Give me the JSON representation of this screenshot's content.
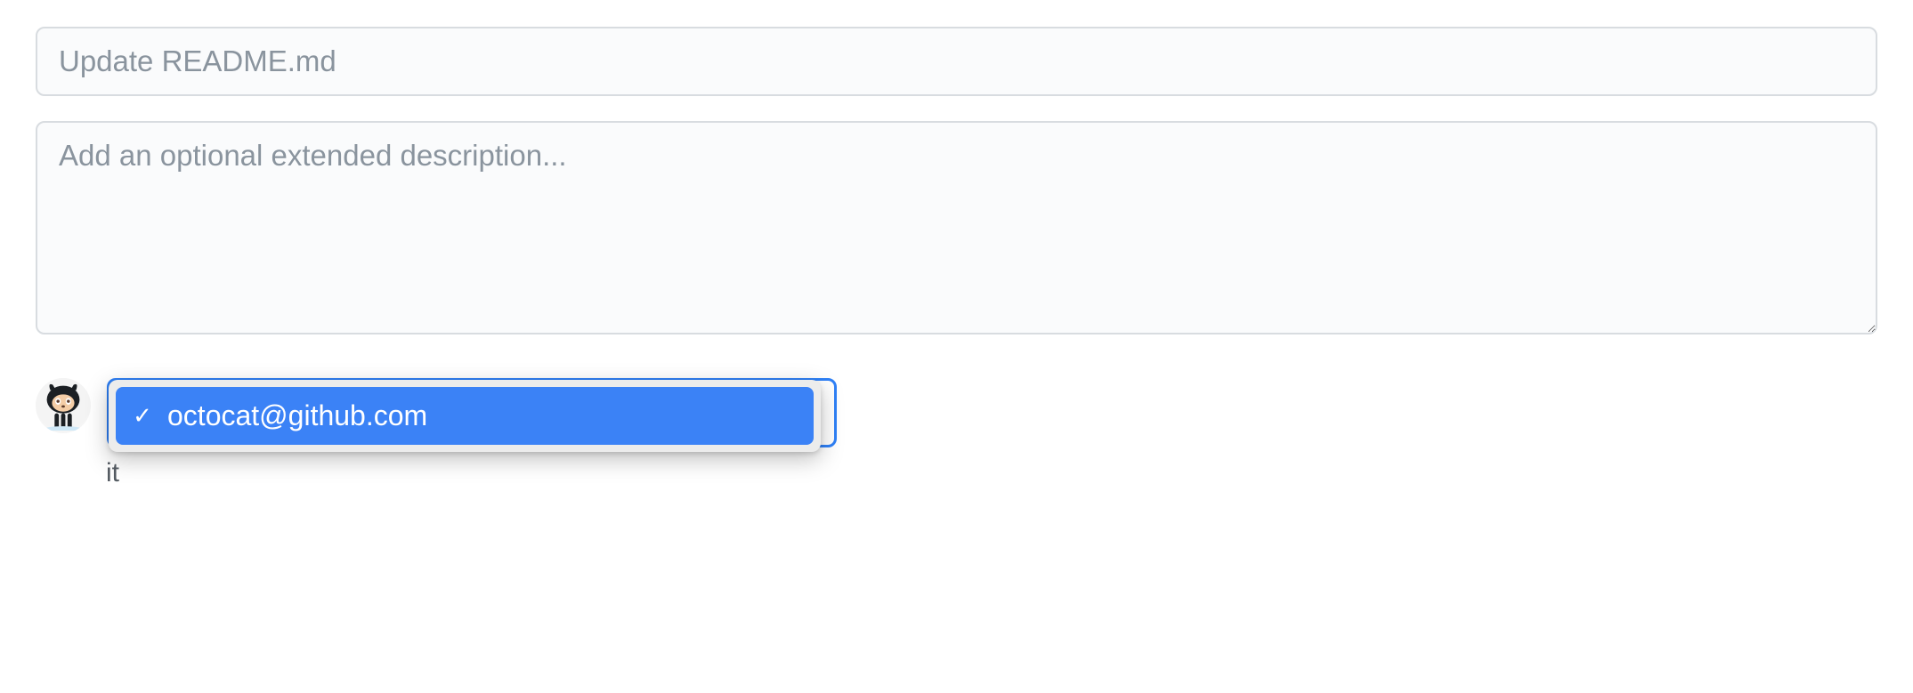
{
  "commit": {
    "summary_placeholder": "Update README.md",
    "description_placeholder": "Add an optional extended description..."
  },
  "author": {
    "dropdown": {
      "selected": "octocat@github.com",
      "options": [
        {
          "label": "octocat@github.com",
          "checked": true
        }
      ]
    }
  },
  "partial_text_behind": "it",
  "checkmark": "✓"
}
